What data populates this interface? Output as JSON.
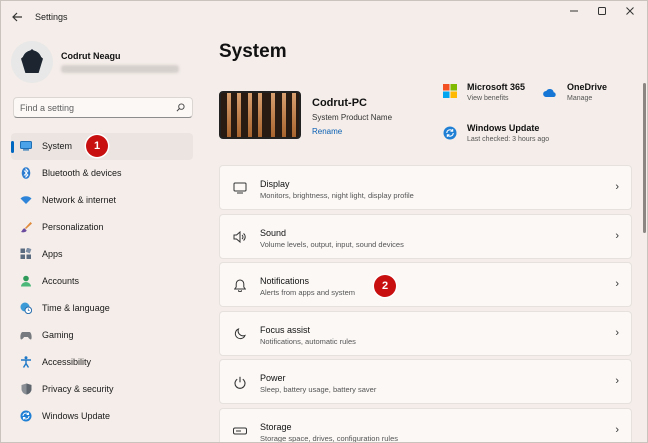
{
  "window": {
    "title": "Settings",
    "controls": [
      "minimize",
      "maximize",
      "close"
    ]
  },
  "profile": {
    "name": "Codrut Neagu"
  },
  "search": {
    "placeholder": "Find a setting"
  },
  "sidebar": {
    "items": [
      {
        "label": "System",
        "icon": "monitor-icon",
        "active": true
      },
      {
        "label": "Bluetooth & devices",
        "icon": "bluetooth-icon"
      },
      {
        "label": "Network & internet",
        "icon": "wifi-icon"
      },
      {
        "label": "Personalization",
        "icon": "brush-icon"
      },
      {
        "label": "Apps",
        "icon": "apps-icon"
      },
      {
        "label": "Accounts",
        "icon": "person-icon"
      },
      {
        "label": "Time & language",
        "icon": "globe-clock-icon"
      },
      {
        "label": "Gaming",
        "icon": "gamepad-icon"
      },
      {
        "label": "Accessibility",
        "icon": "accessibility-icon"
      },
      {
        "label": "Privacy & security",
        "icon": "shield-icon"
      },
      {
        "label": "Windows Update",
        "icon": "update-icon"
      }
    ]
  },
  "annotations": {
    "badge1": "1",
    "badge2": "2",
    "color": "#c81010"
  },
  "main": {
    "title": "System",
    "device": {
      "name": "Codrut-PC",
      "model": "System Product Name",
      "rename_label": "Rename"
    },
    "services": [
      {
        "title": "Microsoft 365",
        "sub": "View benefits",
        "icon": "microsoft-365-icon"
      },
      {
        "title": "OneDrive",
        "sub": "Manage",
        "icon": "onedrive-icon"
      },
      {
        "title": "Windows Update",
        "sub": "Last checked: 3 hours ago",
        "icon": "windows-update-icon"
      }
    ],
    "cards": [
      {
        "title": "Display",
        "sub": "Monitors, brightness, night light, display profile",
        "icon": "display-icon"
      },
      {
        "title": "Sound",
        "sub": "Volume levels, output, input, sound devices",
        "icon": "speaker-icon"
      },
      {
        "title": "Notifications",
        "sub": "Alerts from apps and system",
        "icon": "bell-icon"
      },
      {
        "title": "Focus assist",
        "sub": "Notifications, automatic rules",
        "icon": "moon-icon"
      },
      {
        "title": "Power",
        "sub": "Sleep, battery usage, battery saver",
        "icon": "power-icon"
      },
      {
        "title": "Storage",
        "sub": "Storage space, drives, configuration rules",
        "icon": "storage-icon"
      }
    ]
  },
  "colors": {
    "accent": "#0067c0",
    "background": "#f4ede9",
    "card": "#fbf8f6"
  }
}
